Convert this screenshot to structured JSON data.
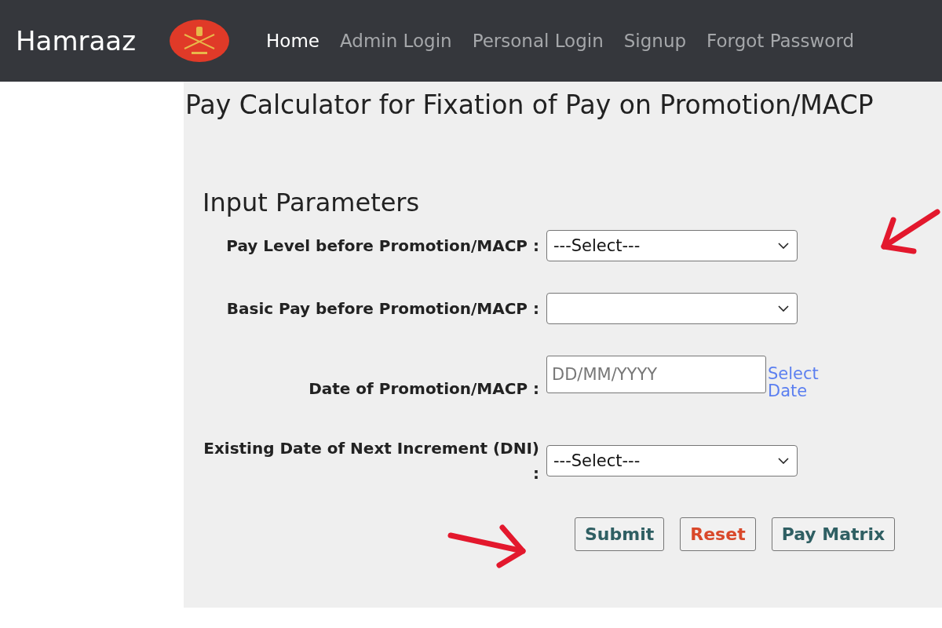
{
  "navbar": {
    "brand": "Hamraaz",
    "links": [
      {
        "label": "Home",
        "selected": true
      },
      {
        "label": "Admin Login",
        "selected": false
      },
      {
        "label": "Personal Login",
        "selected": false
      },
      {
        "label": "Signup",
        "selected": false
      },
      {
        "label": "Forgot Password",
        "selected": false
      }
    ]
  },
  "page_title": "Pay Calculator for Fixation of Pay on Promotion/MACP",
  "section_title": "Input Parameters",
  "fields": [
    {
      "kind": "select",
      "label": "Pay Level before Promotion/MACP :",
      "value": "---Select---"
    },
    {
      "kind": "select",
      "label": "Basic Pay before Promotion/MACP :"
    },
    {
      "kind": "date",
      "label": "Date of Promotion/MACP :",
      "placeholder": "DD/MM/YYYY",
      "link": "Select Date"
    },
    {
      "kind": "select",
      "label": "Existing Date of Next Increment (DNI) :",
      "value": "---Select---"
    }
  ],
  "buttons": [
    {
      "label": "Submit",
      "kind": "primary"
    },
    {
      "label": "Reset",
      "kind": "danger"
    },
    {
      "label": "Pay Matrix",
      "kind": "primary"
    }
  ]
}
